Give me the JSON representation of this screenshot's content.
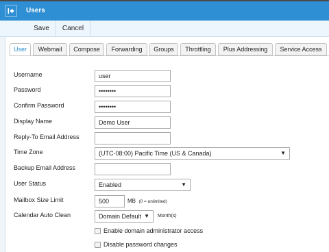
{
  "window": {
    "title": "Users"
  },
  "toolbar": {
    "save": "Save",
    "cancel": "Cancel"
  },
  "tabs": [
    {
      "label": "User",
      "active": true
    },
    {
      "label": "Webmail"
    },
    {
      "label": "Compose"
    },
    {
      "label": "Forwarding"
    },
    {
      "label": "Groups"
    },
    {
      "label": "Throttling"
    },
    {
      "label": "Plus Addressing"
    },
    {
      "label": "Service Access"
    }
  ],
  "form": {
    "username": {
      "label": "Username",
      "value": "user"
    },
    "password": {
      "label": "Password",
      "value": "••••••••"
    },
    "confirm_password": {
      "label": "Confirm Password",
      "value": "••••••••"
    },
    "display_name": {
      "label": "Display Name",
      "value": "Demo User"
    },
    "reply_to": {
      "label": "Reply-To Email Address",
      "value": ""
    },
    "time_zone": {
      "label": "Time Zone",
      "value": "(UTC-08:00) Pacific Time (US & Canada)"
    },
    "backup_email": {
      "label": "Backup Email Address",
      "value": ""
    },
    "user_status": {
      "label": "User Status",
      "value": "Enabled"
    },
    "mailbox_size": {
      "label": "Mailbox Size Limit",
      "value": "500",
      "unit": "MB",
      "hint": "(0 = unlimited)"
    },
    "calendar_auto_clean": {
      "label": "Calendar Auto Clean",
      "value": "Domain Default",
      "unit": "Month(s)"
    },
    "enable_domain_admin": {
      "label": "Enable domain administrator access",
      "checked": false
    },
    "disable_password_changes": {
      "label": "Disable password changes",
      "checked": false
    }
  },
  "colors": {
    "accent": "#2e8fd4",
    "toolbar_bg": "#eef6fd"
  },
  "icons": {
    "back": "collapse-left-icon",
    "dropdown": "caret-down-icon"
  }
}
